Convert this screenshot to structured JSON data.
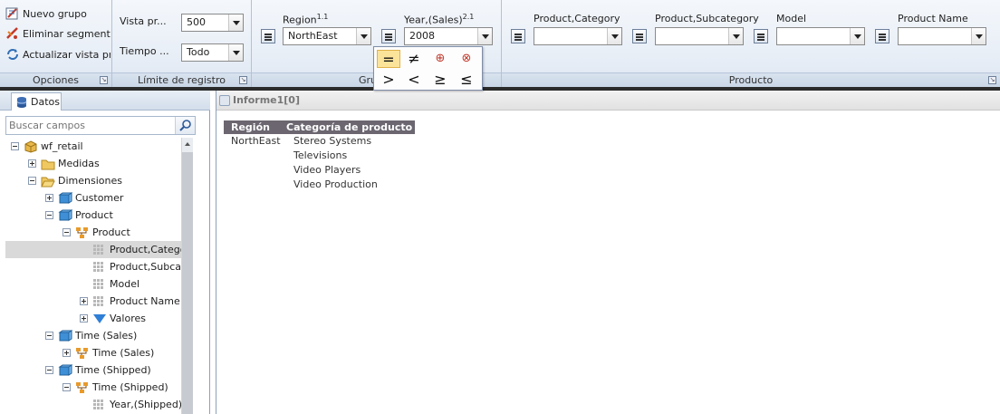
{
  "ribbon": {
    "opciones": {
      "label": "Opciones",
      "items": [
        {
          "label": "Nuevo grupo",
          "icon": "new-group-icon"
        },
        {
          "label": "Eliminar segmentación",
          "icon": "delete-segmentation-icon"
        },
        {
          "label": "Actualizar vista previa",
          "icon": "refresh-preview-icon"
        }
      ]
    },
    "limite": {
      "label": "Límite de registro",
      "vista_label": "Vista pr...",
      "vista_value": "500",
      "tiempo_label": "Tiempo ...",
      "tiempo_value": "Todo"
    },
    "grupo": {
      "label": "Gru",
      "region_header": "Region",
      "region_sup": "1.1",
      "region_value": "NorthEast",
      "year_header": "Year,(Sales)",
      "year_sup": "2.1",
      "year_value": "2008"
    },
    "producto": {
      "label": "Producto",
      "fields": [
        {
          "header": "Product,Category",
          "value": ""
        },
        {
          "header": "Product,Subcategory",
          "value": ""
        },
        {
          "header": "Model",
          "value": ""
        },
        {
          "header": "Product Name",
          "value": ""
        }
      ]
    },
    "operators": [
      "=",
      "≠",
      "⊕",
      "⊗",
      ">",
      "<",
      "≥",
      "≤"
    ]
  },
  "left_panel": {
    "tab_label": "Datos",
    "search_placeholder": "Buscar campos",
    "tree": [
      {
        "label": "wf_retail",
        "expander": "minus",
        "icon": "cube-icon",
        "level": 0
      },
      {
        "label": "Medidas",
        "expander": "plus",
        "icon": "folder-icon",
        "level": 1
      },
      {
        "label": "Dimensiones",
        "expander": "minus",
        "icon": "folder-open-icon",
        "level": 1
      },
      {
        "label": "Customer",
        "expander": "plus",
        "icon": "dimension-icon",
        "level": 2
      },
      {
        "label": "Product",
        "expander": "minus",
        "icon": "dimension-icon",
        "level": 2
      },
      {
        "label": "Product",
        "expander": "minus",
        "icon": "hierarchy-icon",
        "level": 3
      },
      {
        "label": "Product,Category",
        "expander": "",
        "icon": "level-icon",
        "level": 4,
        "selected": true
      },
      {
        "label": "Product,Subcategory",
        "expander": "",
        "icon": "level-icon",
        "level": 4
      },
      {
        "label": "Model",
        "expander": "",
        "icon": "level-icon",
        "level": 4
      },
      {
        "label": "Product Name",
        "expander": "plus",
        "icon": "level-icon",
        "level": 4
      },
      {
        "label": "Valores",
        "expander": "plus",
        "icon": "filter-icon",
        "level": 4
      },
      {
        "label": "Time (Sales)",
        "expander": "minus",
        "icon": "dimension-icon",
        "level": 2
      },
      {
        "label": "Time (Sales)",
        "expander": "plus",
        "icon": "hierarchy-icon",
        "level": 3
      },
      {
        "label": "Time (Shipped)",
        "expander": "minus",
        "icon": "dimension-icon",
        "level": 2
      },
      {
        "label": "Time (Shipped)",
        "expander": "minus",
        "icon": "hierarchy-icon",
        "level": 3
      },
      {
        "label": "Year,(Shipped)",
        "expander": "",
        "icon": "level-icon",
        "level": 4
      }
    ]
  },
  "report": {
    "title": "Informe1[0]",
    "headers": [
      "Región",
      "Categoría de producto"
    ],
    "region": "NorthEast",
    "categories": [
      "Stereo Systems",
      "Televisions",
      "Video Players",
      "Video Production"
    ]
  }
}
